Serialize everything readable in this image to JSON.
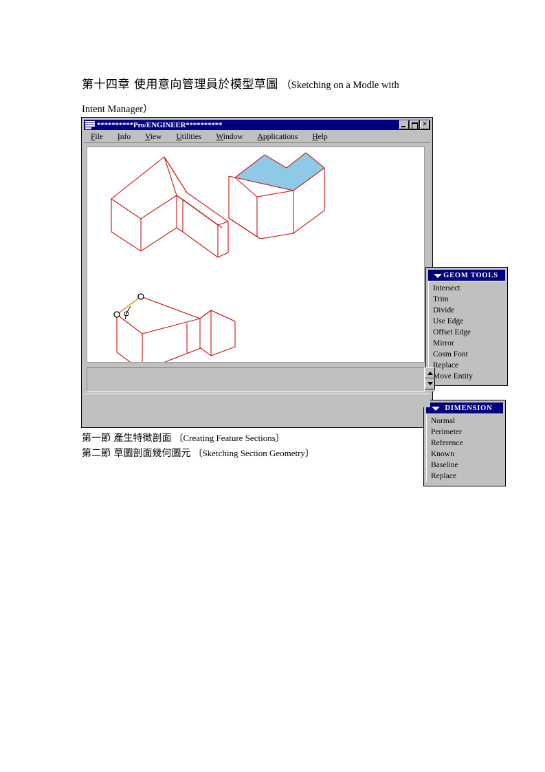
{
  "document": {
    "heading": {
      "line1_cjk": "第十四章 使用意向管理員於模型草圖",
      "line1_latin": "（Sketching on a Modle with",
      "line2_latin": "Intent Manager）"
    },
    "footer": [
      {
        "cjk": "第一節 產生特徵剖面",
        "latin": "〔Creating Feature Sections〕"
      },
      {
        "cjk": "第二節 草圖剖面幾何圖元",
        "latin": "〔Sketching Section Geometry〕"
      }
    ]
  },
  "window": {
    "title": "**********Pro/ENGINEER**********",
    "sysmenu_icon": "system-menu-icon",
    "controls": [
      {
        "name": "minimize-button",
        "label": "_"
      },
      {
        "name": "maximize-button",
        "label": "□"
      },
      {
        "name": "close-button",
        "label": "✕"
      }
    ],
    "menubar": [
      {
        "acc": "F",
        "rest": "ile"
      },
      {
        "acc": "I",
        "rest": "nfo"
      },
      {
        "acc": "V",
        "rest": "iew"
      },
      {
        "acc": "U",
        "rest": "tilities"
      },
      {
        "acc": "W",
        "rest": "indow"
      },
      {
        "acc": "A",
        "rest": "pplications"
      },
      {
        "acc": "H",
        "rest": "elp"
      }
    ],
    "message_text": ""
  },
  "panels": [
    {
      "id": "geom-tools",
      "title": "GEOM TOOLS",
      "collapse_icon": "triangle-down-icon",
      "items": [
        "Intersect",
        "Trim",
        "Divide",
        "Use Edge",
        "Offset Edge",
        "Mirror",
        "Cosm Font",
        "Replace",
        "Move Entity"
      ]
    },
    {
      "id": "dimension",
      "title": "DIMENSION",
      "collapse_icon": "triangle-down-icon",
      "items": [
        "Normal",
        "Perimeter",
        "Reference",
        "Known",
        "Baseline",
        "Replace"
      ]
    }
  ],
  "colors": {
    "titlebar": "#000080",
    "chrome": "#c0c0c0",
    "canvas": "#ffffff",
    "wireframe": "#cc1111",
    "highlight_face": "#8ecae6",
    "highlight_edge": "#d4a017"
  },
  "canvas": {
    "models": [
      {
        "name": "l-shaped-block-top-left",
        "style": "wireframe"
      },
      {
        "name": "box-with-highlighted-top-face",
        "style": "shaded-face"
      },
      {
        "name": "block-with-selected-edge",
        "style": "wireframe-with-markers"
      }
    ]
  }
}
